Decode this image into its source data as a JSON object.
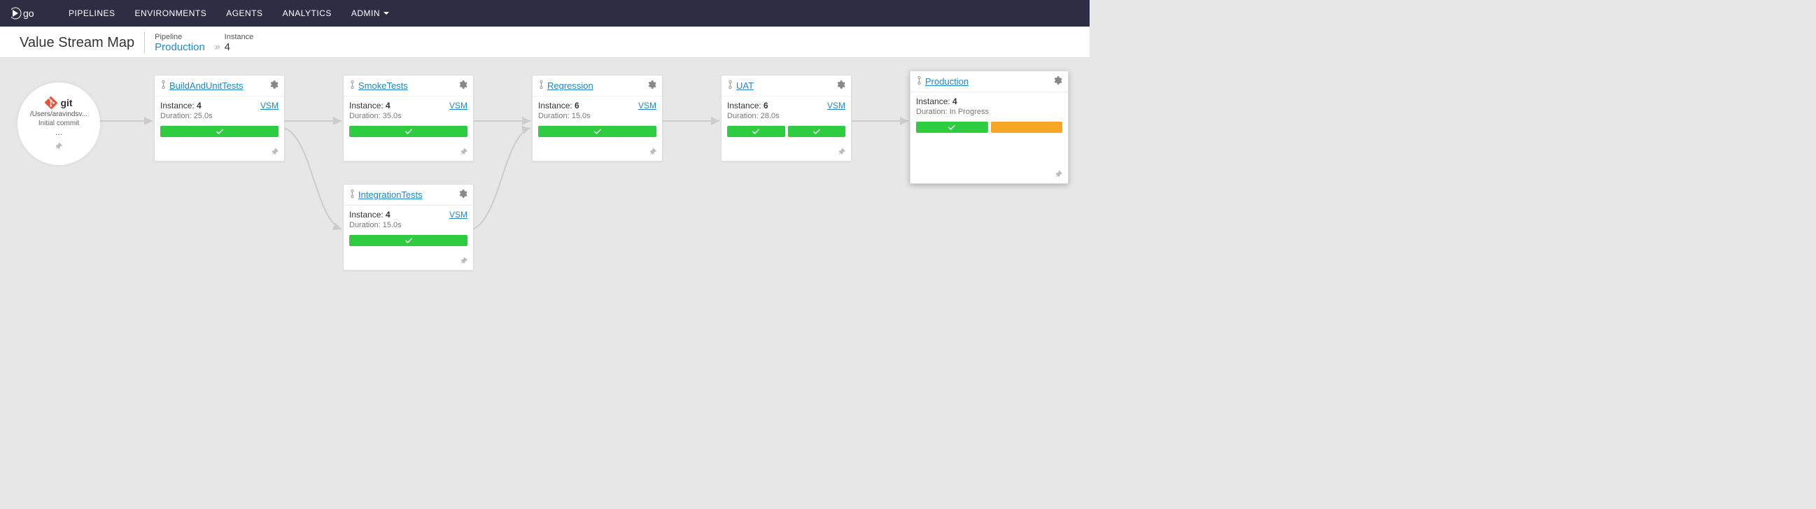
{
  "nav": {
    "items": [
      "PIPELINES",
      "ENVIRONMENTS",
      "AGENTS",
      "ANALYTICS",
      "ADMIN"
    ]
  },
  "header": {
    "title": "Value Stream Map",
    "pipeline_label": "Pipeline",
    "pipeline_value": "Production",
    "instance_label": "Instance",
    "instance_value": "4"
  },
  "material": {
    "type": "git",
    "path": "/Users/aravindsv...",
    "commit": "Initial commit",
    "more": "..."
  },
  "vsm_label": "VSM",
  "instance_prefix": "Instance: ",
  "duration_prefix": "Duration: ",
  "cards": {
    "build": {
      "name": "BuildAndUnitTests",
      "instance": "4",
      "duration": "25.0s",
      "stages": [
        {
          "status": "passed"
        }
      ]
    },
    "smoke": {
      "name": "SmokeTests",
      "instance": "4",
      "duration": "35.0s",
      "stages": [
        {
          "status": "passed"
        }
      ]
    },
    "integ": {
      "name": "IntegrationTests",
      "instance": "4",
      "duration": "15.0s",
      "stages": [
        {
          "status": "passed"
        }
      ]
    },
    "regress": {
      "name": "Regression",
      "instance": "6",
      "duration": "15.0s",
      "stages": [
        {
          "status": "passed"
        }
      ]
    },
    "uat": {
      "name": "UAT",
      "instance": "6",
      "duration": "28.0s",
      "stages": [
        {
          "status": "passed"
        },
        {
          "status": "passed"
        }
      ]
    },
    "prod": {
      "name": "Production",
      "instance": "4",
      "duration": "In Progress",
      "stages": [
        {
          "status": "passed"
        },
        {
          "status": "building"
        }
      ]
    }
  }
}
